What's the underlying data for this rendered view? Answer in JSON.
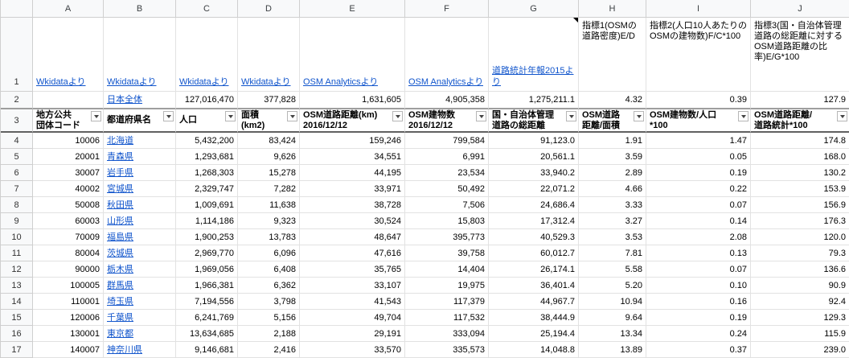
{
  "colgroup": [
    "A",
    "B",
    "C",
    "D",
    "E",
    "F",
    "G",
    "H",
    "I",
    "J"
  ],
  "row1": {
    "num": "1",
    "a": "Wkidataより",
    "b": "Wkidataより",
    "c": "Wkidataより",
    "d": "Wkidataより",
    "e": "OSM Analyticsより",
    "f": "OSM Analyticsより",
    "g": "道路統計年報2015より",
    "h": "指標1(OSMの道路密度)E/D",
    "i": "指標2(人口10人あたりのOSMの建物数)F/C*100",
    "j": "指標3(国・自治体管理道路の総距離に対するOSM道路距離の比率)E/G*100"
  },
  "row2": {
    "num": "2",
    "b": "日本全体",
    "c": "127,016,470",
    "d": "377,828",
    "e": "1,631,605",
    "f": "4,905,358",
    "g": "1,275,211.1",
    "h": "4.32",
    "i": "0.39",
    "j": "127.9"
  },
  "row3": {
    "num": "3",
    "headers": [
      "地方公共\n団体コード",
      "都道府県名",
      "人口",
      "面積\n(km2)",
      "OSM道路距離(km)\n2016/12/12",
      "OSM建物数\n2016/12/12",
      "国・自治体管理\n道路の総距離",
      "OSM道路\n距離/面積",
      "OSM建物数/人口\n*100",
      "OSM道路距離/\n道路統計*100"
    ]
  },
  "rows": [
    {
      "num": "4",
      "cells": [
        "10006",
        "北海道",
        "5,432,200",
        "83,424",
        "159,246",
        "799,584",
        "91,123.0",
        "1.91",
        "1.47",
        "174.8"
      ]
    },
    {
      "num": "5",
      "cells": [
        "20001",
        "青森県",
        "1,293,681",
        "9,626",
        "34,551",
        "6,991",
        "20,561.1",
        "3.59",
        "0.05",
        "168.0"
      ]
    },
    {
      "num": "6",
      "cells": [
        "30007",
        "岩手県",
        "1,268,303",
        "15,278",
        "44,195",
        "23,534",
        "33,940.2",
        "2.89",
        "0.19",
        "130.2"
      ]
    },
    {
      "num": "7",
      "cells": [
        "40002",
        "宮城県",
        "2,329,747",
        "7,282",
        "33,971",
        "50,492",
        "22,071.2",
        "4.66",
        "0.22",
        "153.9"
      ]
    },
    {
      "num": "8",
      "cells": [
        "50008",
        "秋田県",
        "1,009,691",
        "11,638",
        "38,728",
        "7,506",
        "24,686.4",
        "3.33",
        "0.07",
        "156.9"
      ]
    },
    {
      "num": "9",
      "cells": [
        "60003",
        "山形県",
        "1,114,186",
        "9,323",
        "30,524",
        "15,803",
        "17,312.4",
        "3.27",
        "0.14",
        "176.3"
      ]
    },
    {
      "num": "10",
      "cells": [
        "70009",
        "福島県",
        "1,900,253",
        "13,783",
        "48,647",
        "395,773",
        "40,529.3",
        "3.53",
        "2.08",
        "120.0"
      ]
    },
    {
      "num": "11",
      "cells": [
        "80004",
        "茨城県",
        "2,969,770",
        "6,096",
        "47,616",
        "39,758",
        "60,012.7",
        "7.81",
        "0.13",
        "79.3"
      ]
    },
    {
      "num": "12",
      "cells": [
        "90000",
        "栃木県",
        "1,969,056",
        "6,408",
        "35,765",
        "14,404",
        "26,174.1",
        "5.58",
        "0.07",
        "136.6"
      ]
    },
    {
      "num": "13",
      "cells": [
        "100005",
        "群馬県",
        "1,966,381",
        "6,362",
        "33,107",
        "19,975",
        "36,401.4",
        "5.20",
        "0.10",
        "90.9"
      ]
    },
    {
      "num": "14",
      "cells": [
        "110001",
        "埼玉県",
        "7,194,556",
        "3,798",
        "41,543",
        "117,379",
        "44,967.7",
        "10.94",
        "0.16",
        "92.4"
      ]
    },
    {
      "num": "15",
      "cells": [
        "120006",
        "千葉県",
        "6,241,769",
        "5,156",
        "49,704",
        "117,532",
        "38,444.9",
        "9.64",
        "0.19",
        "129.3"
      ]
    },
    {
      "num": "16",
      "cells": [
        "130001",
        "東京都",
        "13,634,685",
        "2,188",
        "29,191",
        "333,094",
        "25,194.4",
        "13.34",
        "0.24",
        "115.9"
      ]
    },
    {
      "num": "17",
      "cells": [
        "140007",
        "神奈川県",
        "9,146,681",
        "2,416",
        "33,570",
        "335,573",
        "14,048.8",
        "13.89",
        "0.37",
        "239.0"
      ]
    }
  ]
}
